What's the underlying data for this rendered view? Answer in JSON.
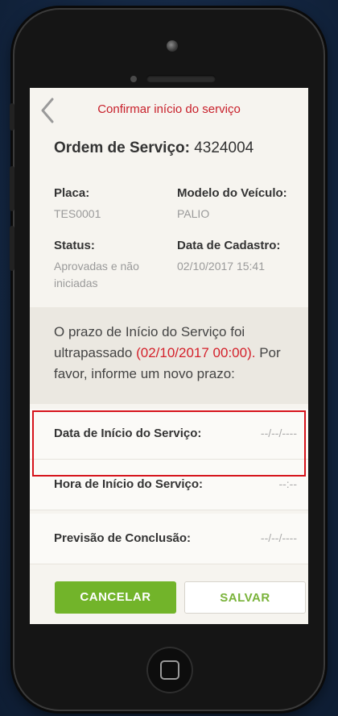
{
  "header": {
    "title": "Confirmar início do serviço"
  },
  "order": {
    "label": "Ordem de Serviço:",
    "number": "4324004"
  },
  "details": {
    "placa_label": "Placa:",
    "placa_value": "TES0001",
    "modelo_label": "Modelo do Veículo:",
    "modelo_value": "PALIO",
    "status_label": "Status:",
    "status_line1": "Aprovadas e não",
    "status_line2": "iniciadas",
    "cadastro_label": "Data de Cadastro:",
    "cadastro_value": "02/10/2017 15:41"
  },
  "notice": {
    "part1": "O prazo de Início do Serviço foi ultrapassado ",
    "date": "(02/10/2017 00:00).",
    "part2": " Por favor, informe um novo prazo:"
  },
  "fields": {
    "data_inicio_label": "Data de Início do Serviço:",
    "data_inicio_value": "--/--/----",
    "hora_inicio_label": "Hora de Início do Serviço:",
    "hora_inicio_value": "--:--",
    "previsao_label": "Previsão de Conclusão:",
    "previsao_value": "--/--/----"
  },
  "buttons": {
    "cancel": "CANCELAR",
    "save": "SALVAR"
  },
  "colors": {
    "accent_red": "#d4202a",
    "accent_green": "#72b42a"
  }
}
